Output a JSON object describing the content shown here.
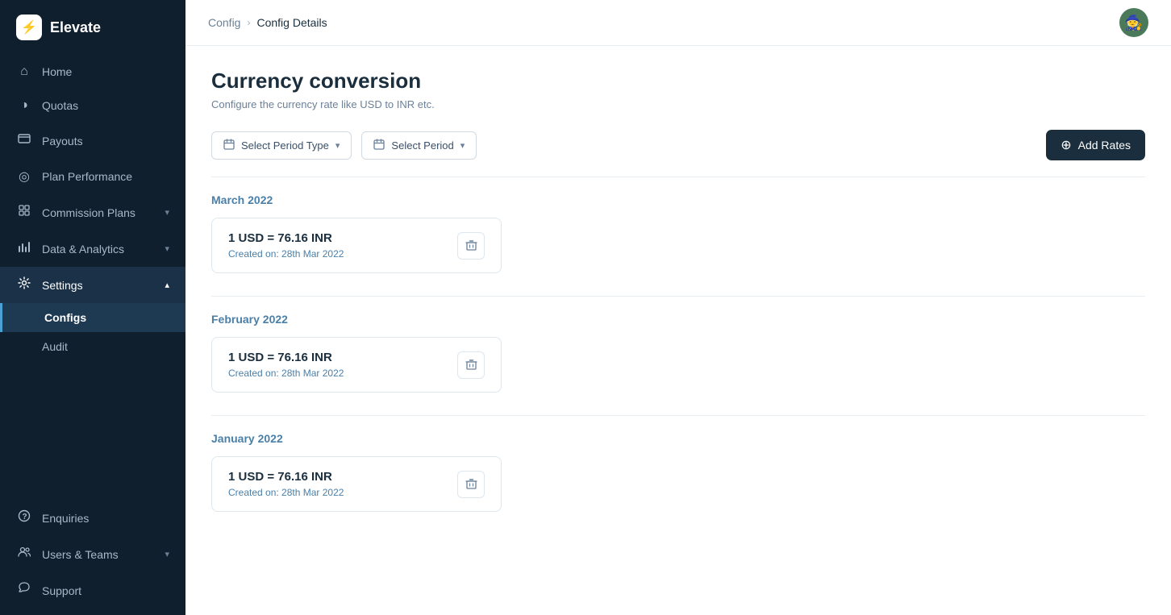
{
  "app": {
    "name": "Elevate"
  },
  "sidebar": {
    "nav_items": [
      {
        "id": "home",
        "label": "Home",
        "icon": "⌂",
        "active": false,
        "has_sub": false
      },
      {
        "id": "quotas",
        "label": "Quotas",
        "icon": "◑",
        "active": false,
        "has_sub": false
      },
      {
        "id": "payouts",
        "label": "Payouts",
        "icon": "☐",
        "active": false,
        "has_sub": false
      },
      {
        "id": "plan-performance",
        "label": "Plan Performance",
        "icon": "◎",
        "active": false,
        "has_sub": false
      },
      {
        "id": "commission-plans",
        "label": "Commission Plans",
        "icon": "≡",
        "active": false,
        "has_sub": true
      },
      {
        "id": "data-analytics",
        "label": "Data & Analytics",
        "icon": "⊞",
        "active": false,
        "has_sub": true
      },
      {
        "id": "settings",
        "label": "Settings",
        "icon": "≡",
        "active": true,
        "has_sub": true
      }
    ],
    "settings_sub": [
      {
        "id": "configs",
        "label": "Configs",
        "active": true
      },
      {
        "id": "audit",
        "label": "Audit",
        "active": false
      }
    ],
    "bottom_items": [
      {
        "id": "enquiries",
        "label": "Enquiries",
        "icon": "?"
      },
      {
        "id": "users-teams",
        "label": "Users & Teams",
        "icon": "👥",
        "has_sub": true
      },
      {
        "id": "support",
        "label": "Support",
        "icon": "💬"
      }
    ]
  },
  "breadcrumb": {
    "parent": "Config",
    "separator": "›",
    "current": "Config Details"
  },
  "page": {
    "title": "Currency conversion",
    "subtitle": "Configure the currency rate like USD to INR etc."
  },
  "filters": {
    "period_type_label": "Select Period Type",
    "period_label": "Select Period",
    "add_rates_label": "+ Add Rates"
  },
  "periods": [
    {
      "id": "march-2022",
      "heading": "March 2022",
      "rate_value": "1 USD = 76.16 INR",
      "created_on": "Created on: 28th Mar 2022"
    },
    {
      "id": "february-2022",
      "heading": "February 2022",
      "rate_value": "1 USD = 76.16 INR",
      "created_on": "Created on: 28th Mar 2022"
    },
    {
      "id": "january-2022",
      "heading": "January 2022",
      "rate_value": "1 USD = 76.16 INR",
      "created_on": "Created on: 28th Mar 2022"
    }
  ]
}
